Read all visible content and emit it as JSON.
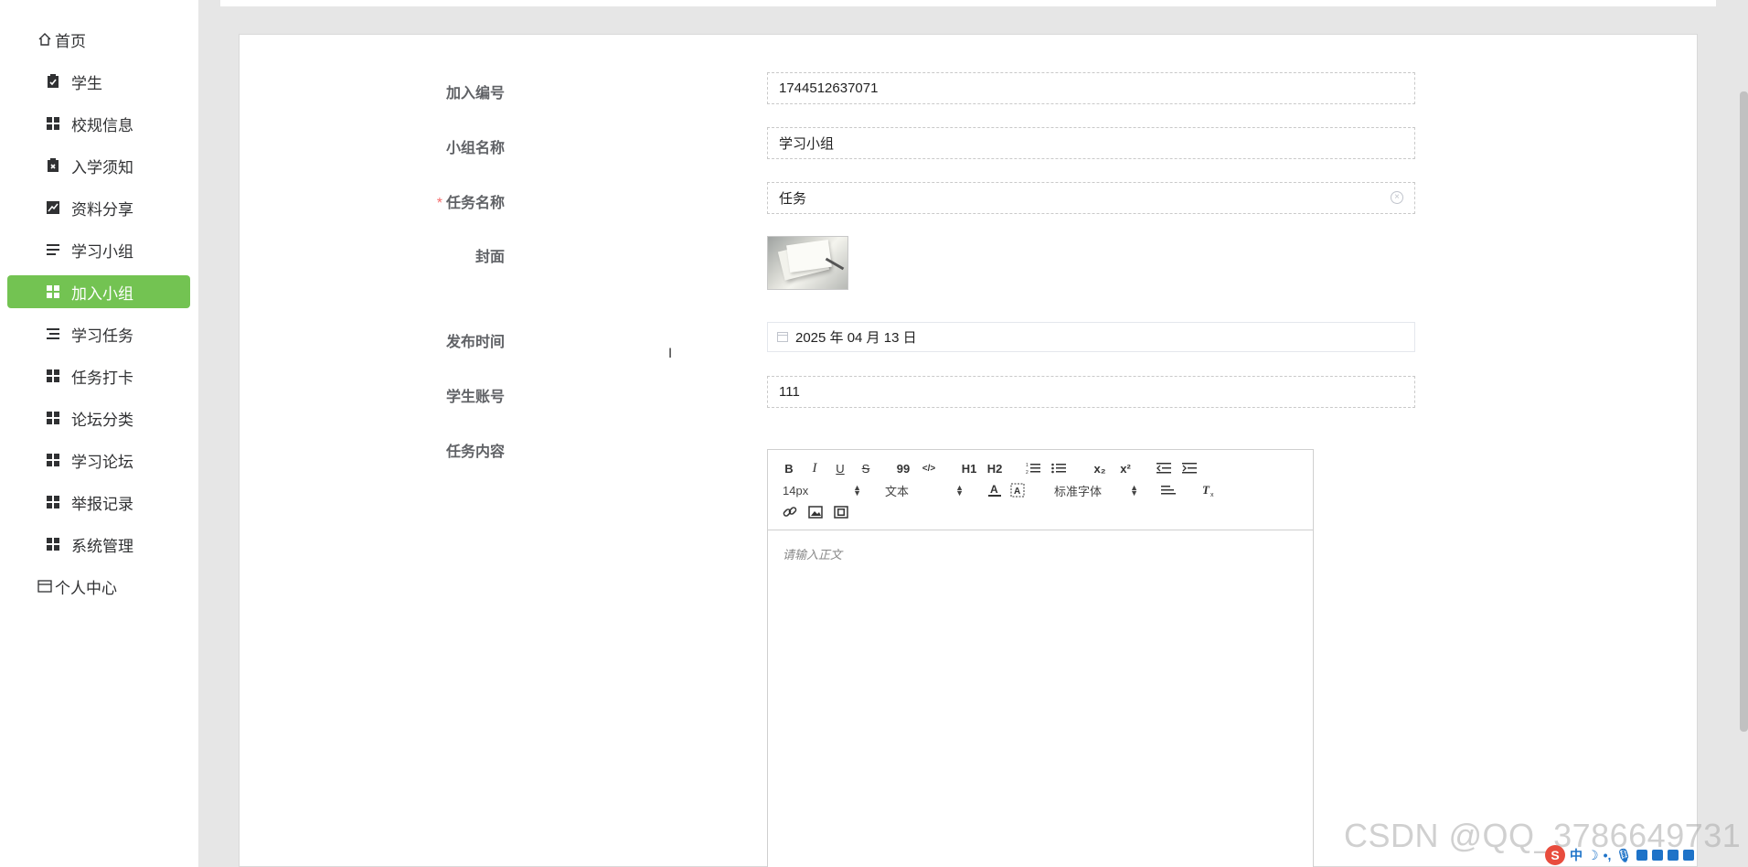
{
  "sidebar": {
    "items": [
      {
        "label": "首页",
        "icon": "home-icon"
      },
      {
        "label": "学生",
        "icon": "clipboard-check-icon"
      },
      {
        "label": "校规信息",
        "icon": "grid-icon"
      },
      {
        "label": "入学须知",
        "icon": "clipboard-x-icon"
      },
      {
        "label": "资料分享",
        "icon": "trend-chart-icon"
      },
      {
        "label": "学习小组",
        "icon": "list-icon"
      },
      {
        "label": "加入小组",
        "icon": "grid-icon",
        "active": true
      },
      {
        "label": "学习任务",
        "icon": "indented-list-icon"
      },
      {
        "label": "任务打卡",
        "icon": "grid-icon"
      },
      {
        "label": "论坛分类",
        "icon": "grid-icon"
      },
      {
        "label": "学习论坛",
        "icon": "grid-icon"
      },
      {
        "label": "举报记录",
        "icon": "grid-icon"
      },
      {
        "label": "系统管理",
        "icon": "grid-icon"
      },
      {
        "label": "个人中心",
        "icon": "profile-card-icon"
      }
    ],
    "active_color": "#73c352"
  },
  "form": {
    "join_no": {
      "label": "加入编号",
      "value": "1744512637071"
    },
    "group_name": {
      "label": "小组名称",
      "value": "学习小组"
    },
    "task_name": {
      "label": "任务名称",
      "value": "任务",
      "required_mark": "*"
    },
    "cover": {
      "label": "封面"
    },
    "publish_time": {
      "label": "发布时间",
      "value": "2025 年 04 月 13 日"
    },
    "student_account": {
      "label": "学生账号",
      "value": "111"
    },
    "task_content": {
      "label": "任务内容"
    }
  },
  "editor": {
    "toolbar": {
      "bold": "B",
      "italic": "I",
      "underline": "U",
      "strike": "S",
      "quote": "99",
      "code": "</>",
      "h1": "H1",
      "h2": "H2",
      "subscript": "x₂",
      "superscript": "x²",
      "font_size": "14px",
      "text_type": "文本",
      "font_family": "标准字体"
    },
    "placeholder": "请输入正文"
  },
  "watermark": "CSDN @QQ_3786649731",
  "ime": {
    "mode_label": "中"
  }
}
